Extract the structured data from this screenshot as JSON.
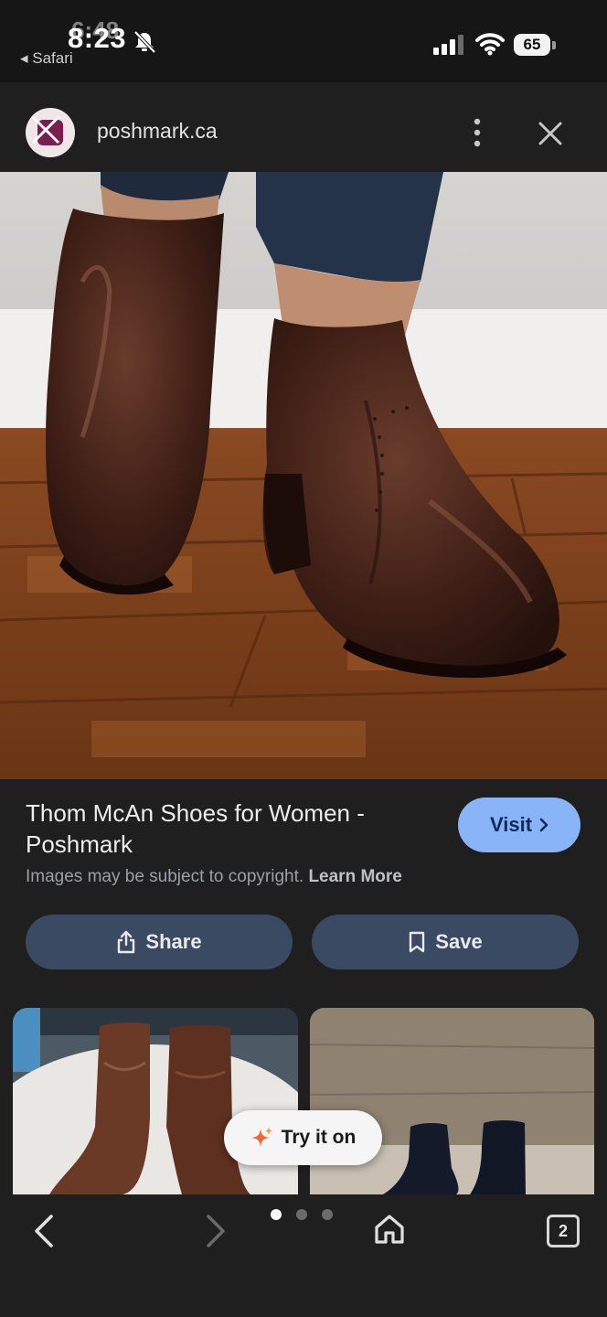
{
  "status_bar": {
    "time": "8:23",
    "time_ghost": "6:48",
    "back_app": "Safari",
    "battery": "65",
    "icons": [
      "bell-slash-icon",
      "signal-icon",
      "wifi-icon",
      "battery-icon"
    ]
  },
  "header": {
    "site": "poshmark.ca",
    "icons": [
      "site-logo",
      "more-vert-icon",
      "close-icon"
    ]
  },
  "result": {
    "title": "Thom McAn Shoes for Women - Poshmark",
    "visit_label": "Visit",
    "copyright_text": "Images may be subject to copyright.",
    "learn_more": "Learn More"
  },
  "actions": {
    "share_label": "Share",
    "save_label": "Save"
  },
  "related": {
    "try_on_label": "Try it on"
  },
  "bottom_nav": {
    "tabs_count": "2",
    "page_dots": 3,
    "active_dot": 0
  }
}
